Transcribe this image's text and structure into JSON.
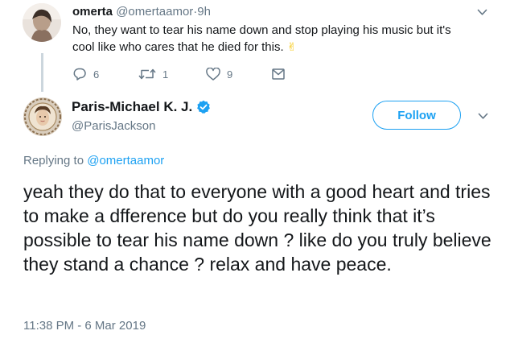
{
  "parent_tweet": {
    "name": "omerta",
    "handle": "@omertaamor",
    "time": "·9h",
    "text": "No, they want to tear his name down and stop playing his music but it's cool like who cares that he died for this.",
    "emoji": "✌",
    "replies": "6",
    "retweets": "1",
    "likes": "9"
  },
  "main_tweet": {
    "name": "Paris-Michael K. J.",
    "handle": "@ParisJackson",
    "follow_label": "Follow",
    "replying_prefix": "Replying to",
    "replying_handle": "@omertaamor",
    "text": "yeah they do that to everyone with a good heart and tries to make a dfference but do you really think that it’s possible to tear his name down ? like do you truly believe they stand a chance ? relax and have peace.",
    "timestamp": "11:38 PM - 6 Mar 2019"
  },
  "colors": {
    "accent": "#1da1f2",
    "secondary_text": "#657786",
    "primary_text": "#14171a",
    "thread_line": "#ccd6dd"
  },
  "icons": [
    "reply-icon",
    "retweet-icon",
    "like-icon",
    "direct-message-icon",
    "verified-badge-icon",
    "chevron-down-icon"
  ]
}
